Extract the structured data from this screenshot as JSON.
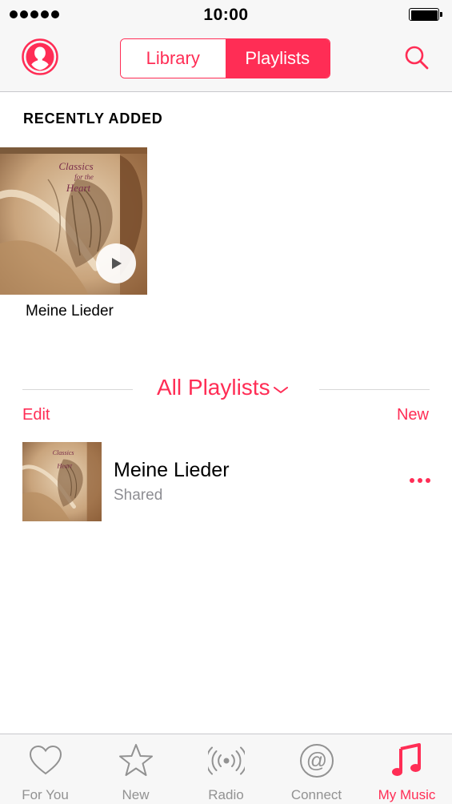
{
  "status_bar": {
    "time": "10:00"
  },
  "nav": {
    "segments": [
      {
        "label": "Library",
        "active": false
      },
      {
        "label": "Playlists",
        "active": true
      }
    ]
  },
  "recently_added": {
    "header": "RECENTLY ADDED",
    "items": [
      {
        "title": "Meine Lieder",
        "cover_art": "Classics for the Heart"
      }
    ]
  },
  "all_playlists": {
    "title": "All Playlists",
    "edit_label": "Edit",
    "new_label": "New",
    "items": [
      {
        "title": "Meine Lieder",
        "subtitle": "Shared"
      }
    ]
  },
  "tab_bar": {
    "tabs": [
      {
        "label": "For You",
        "icon": "heart-icon",
        "active": false
      },
      {
        "label": "New",
        "icon": "star-icon",
        "active": false
      },
      {
        "label": "Radio",
        "icon": "radio-icon",
        "active": false
      },
      {
        "label": "Connect",
        "icon": "at-sign-icon",
        "active": false
      },
      {
        "label": "My Music",
        "icon": "music-note-icon",
        "active": true
      }
    ]
  },
  "colors": {
    "accent": "#ff2d55",
    "secondary_text": "#8e8e93",
    "bar_background": "#f7f7f7"
  }
}
